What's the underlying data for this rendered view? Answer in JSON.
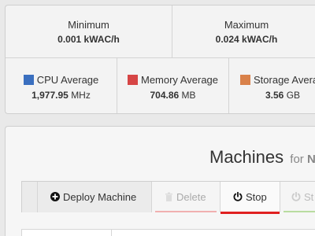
{
  "stats": {
    "minimum": {
      "label": "Minimum",
      "value": "0.001",
      "unit": "kWAC/h"
    },
    "maximum": {
      "label": "Maximum",
      "value": "0.024",
      "unit": "kWAC/h"
    },
    "cpu": {
      "label": "CPU Average",
      "value": "1,977.95",
      "unit": "MHz",
      "color": "#3a6fbf"
    },
    "memory": {
      "label": "Memory Average",
      "value": "704.86",
      "unit": "MB",
      "color": "#d64545"
    },
    "storage": {
      "label": "Storage Average",
      "value": "3.56",
      "unit": "GB",
      "color": "#d9814a"
    }
  },
  "machines": {
    "title": "Machines",
    "subtitle_for": "for",
    "subtitle_rest": "N"
  },
  "toolbar": {
    "deploy_label": "Deploy Machine",
    "delete_label": "Delete",
    "stop_label": "Stop",
    "start_label": "St"
  },
  "icons": {
    "deploy": "plus-circle-icon",
    "delete": "trash-icon",
    "stop": "power-icon",
    "start": "power-icon"
  }
}
